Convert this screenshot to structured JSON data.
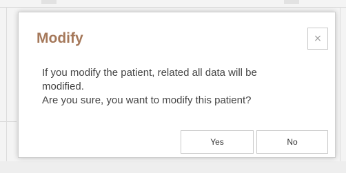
{
  "dialog": {
    "title": "Modify",
    "close_symbol": "×",
    "close_icon": "close-icon",
    "message_lines": [
      "If you modify the patient, related all data will be",
      "modified.",
      "Are you sure, you want to modify this patient?"
    ],
    "yes_label": "Yes",
    "no_label": "No"
  },
  "colors": {
    "title": "#a5785a",
    "text": "#444444",
    "border": "#c9c9c9",
    "background": "#ffffff",
    "backdrop": "#f4f4f4"
  }
}
